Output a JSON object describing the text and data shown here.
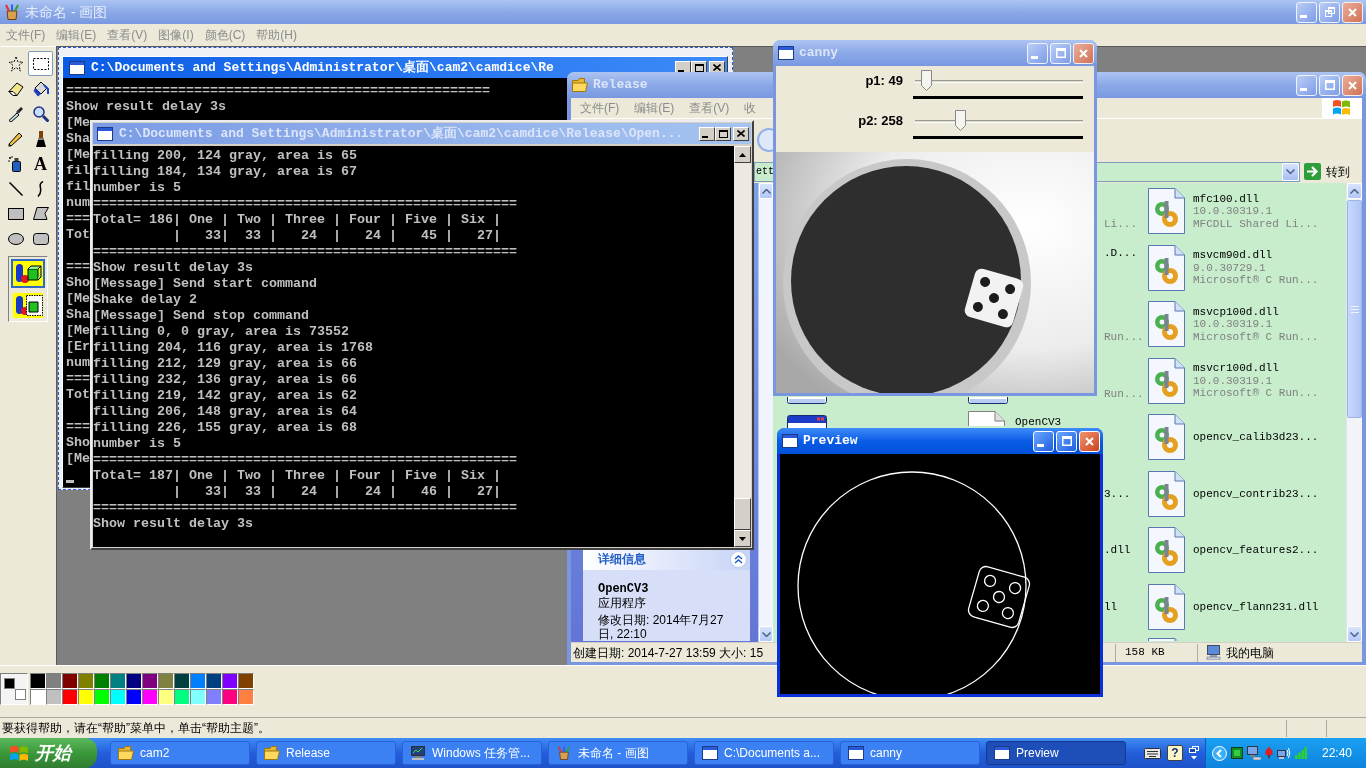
{
  "paint": {
    "title": "未命名 - 画图",
    "active": false,
    "menu": [
      "文件(F)",
      "编辑(E)",
      "查看(V)",
      "图像(I)",
      "颜色(C)",
      "帮助(H)"
    ],
    "tools": [
      {
        "kind": "free-select",
        "selected": false
      },
      {
        "kind": "rect-select",
        "selected": true
      },
      {
        "kind": "eraser",
        "selected": false
      },
      {
        "kind": "fill",
        "selected": false
      },
      {
        "kind": "picker",
        "selected": false
      },
      {
        "kind": "magnifier",
        "selected": false
      },
      {
        "kind": "pencil",
        "selected": false
      },
      {
        "kind": "brush",
        "selected": false
      },
      {
        "kind": "airbrush",
        "selected": false
      },
      {
        "kind": "text",
        "glyph": "A",
        "selected": false
      },
      {
        "kind": "line",
        "selected": false
      },
      {
        "kind": "curve",
        "selected": false
      },
      {
        "kind": "rectangle",
        "selected": false
      },
      {
        "kind": "polygon",
        "selected": false
      },
      {
        "kind": "ellipse",
        "selected": false
      },
      {
        "kind": "rounded-rect",
        "selected": false
      }
    ],
    "tool_options": [
      {
        "kind": "opaque",
        "selected": true
      },
      {
        "kind": "transparent",
        "selected": false
      }
    ],
    "current_colors": [
      {
        "color": "#000000"
      },
      {
        "color": "#ffffff"
      }
    ],
    "palette": [
      {
        "color": "#000000"
      },
      {
        "color": "#808080"
      },
      {
        "color": "#800000"
      },
      {
        "color": "#808000"
      },
      {
        "color": "#008000"
      },
      {
        "color": "#008080"
      },
      {
        "color": "#000080"
      },
      {
        "color": "#800080"
      },
      {
        "color": "#808040"
      },
      {
        "color": "#004040"
      },
      {
        "color": "#0080ff"
      },
      {
        "color": "#004080"
      },
      {
        "color": "#8000ff"
      },
      {
        "color": "#804000"
      },
      {
        "color": "#ffffff"
      },
      {
        "color": "#c0c0c0"
      },
      {
        "color": "#ff0000"
      },
      {
        "color": "#ffff00"
      },
      {
        "color": "#00ff00"
      },
      {
        "color": "#00ffff"
      },
      {
        "color": "#0000ff"
      },
      {
        "color": "#ff00ff"
      },
      {
        "color": "#ffff80"
      },
      {
        "color": "#00ff80"
      },
      {
        "color": "#80ffff"
      },
      {
        "color": "#8080ff"
      },
      {
        "color": "#ff0080"
      },
      {
        "color": "#ff8040"
      }
    ],
    "status": "要获得帮助，请在“帮助”菜单中，单击“帮助主题”。"
  },
  "console_back": {
    "title": "C:\\Documents and Settings\\Administrator\\桌面\\cam2\\camdice\\Re",
    "active": true,
    "blocks": [
      [
        "=====================================================",
        "Show result delay 3s",
        "[Me",
        "Sha",
        "[Me",
        "fil",
        "fil",
        "num",
        "===",
        "Tot"
      ],
      [
        "===",
        "Sho",
        "[Me",
        "Sha",
        "[Me",
        "[Er",
        "num",
        "===",
        "Tot"
      ],
      [
        "===",
        "Sho",
        "[Me"
      ]
    ],
    "cursor": true
  },
  "console_front": {
    "title": "C:\\Documents and Settings\\Administrator\\桌面\\cam2\\camdice\\Release\\Open...",
    "active": false,
    "lines": [
      "filling 200, 124 gray, area is 65",
      "filling 184, 134 gray, area is 67",
      "number is 5",
      "=====================================================",
      "Total= 186| One | Two | Three | Four | Five | Six |",
      "          |   33|  33 |   24  |   24 |   45 |   27|",
      "=====================================================",
      "Show result delay 3s",
      "[Message] Send start command",
      "Shake delay 2",
      "[Message] Send stop command",
      "filling 0, 0 gray, area is 73552",
      "filling 204, 116 gray, area is 1768",
      "filling 212, 129 gray, area is 66",
      "filling 232, 136 gray, area is 66",
      "filling 219, 142 gray, area is 62",
      "filling 206, 148 gray, area is 64",
      "filling 226, 155 gray, area is 68",
      "number is 5",
      "=====================================================",
      "Total= 187| One | Two | Three | Four | Five | Six |",
      "          |   33|  33 |   24  |   24 |   46 |   27|",
      "=====================================================",
      "Show result delay 3s"
    ]
  },
  "explorer": {
    "title": "Release",
    "active": false,
    "menu": [
      "文件(F)",
      "编辑(E)",
      "查看(V)",
      "收"
    ],
    "address": "ett",
    "go": "转到",
    "details": {
      "header": "详细信息",
      "name": "OpenCV3",
      "type": "应用程序",
      "modified": "修改日期: 2014年7月27日, 22:10"
    },
    "rows": [
      {
        "middle": {
          "description": "Li..."
        },
        "right": {
          "kind": "library",
          "name": "mfc100.dll",
          "version": "10.0.30319.1",
          "description": "MFCDLL Shared Li..."
        }
      },
      {
        "middle": {
          "name": ".D...",
          "detailed": true
        },
        "right": {
          "kind": "library",
          "name": "msvcm90d.dll",
          "version": "9.0.30729.1",
          "description": "Microsoft® C Run..."
        }
      },
      {
        "middle": {
          "description": "Run..."
        },
        "right": {
          "kind": "library",
          "name": "msvcp100d.dll",
          "version": "10.0.30319.1",
          "description": "Microsoft® C Run..."
        }
      },
      {
        "left": {
          "kind": "application",
          "clipped_above": true
        },
        "middle": {
          "kind": "application",
          "clipped_above": true,
          "description": "Run..."
        },
        "right": {
          "kind": "library",
          "name": "msvcr100d.dll",
          "version": "10.0.30319.1",
          "description": "Microsoft® C Run..."
        }
      },
      {
        "left": {
          "kind": "application",
          "clipped": true
        },
        "middle": {
          "kind": "document",
          "clipped": true,
          "name": "OpenCV3",
          "detailed": true
        },
        "right": {
          "kind": "library",
          "name": "opencv_calib3d23..."
        }
      },
      {
        "middle": {
          "name": "3...",
          "detailed": false
        },
        "right": {
          "kind": "library",
          "name": "opencv_contrib23..."
        }
      },
      {
        "middle": {
          "name": ".dll",
          "detailed": false
        },
        "right": {
          "kind": "library",
          "name": "opencv_features2..."
        }
      },
      {
        "middle": {
          "name": "ll",
          "detailed": false
        },
        "right": {
          "kind": "library",
          "name": "opencv_flann231.dll"
        }
      },
      {
        "right": {
          "kind": "library",
          "clipped": true
        }
      }
    ],
    "status": {
      "info": "创建日期: 2014-7-27 13:59 大小: 15",
      "size": "158 KB",
      "location": "我的电脑"
    }
  },
  "canny": {
    "title": "canny",
    "active": false,
    "trackbars": [
      {
        "label": "p1: 49",
        "level": 0.049
      },
      {
        "label": "p2: 258",
        "level": 0.258
      }
    ]
  },
  "preview": {
    "title": "Preview",
    "active": true
  },
  "taskbar": {
    "start": "开始",
    "tasks": [
      {
        "label": "cam2",
        "kind": "folder",
        "selected": false
      },
      {
        "label": "Release",
        "kind": "folder",
        "selected": false
      },
      {
        "label": "Windows 任务管...",
        "kind": "monitor",
        "selected": false
      },
      {
        "label": "未命名 - 画图",
        "kind": "paint",
        "selected": false
      },
      {
        "label": "C:\\Documents a...",
        "kind": "window",
        "selected": false
      },
      {
        "label": "canny",
        "kind": "window",
        "selected": false
      },
      {
        "label": "Preview",
        "kind": "window",
        "selected": true
      }
    ],
    "help": "?",
    "clock": "22:40"
  }
}
